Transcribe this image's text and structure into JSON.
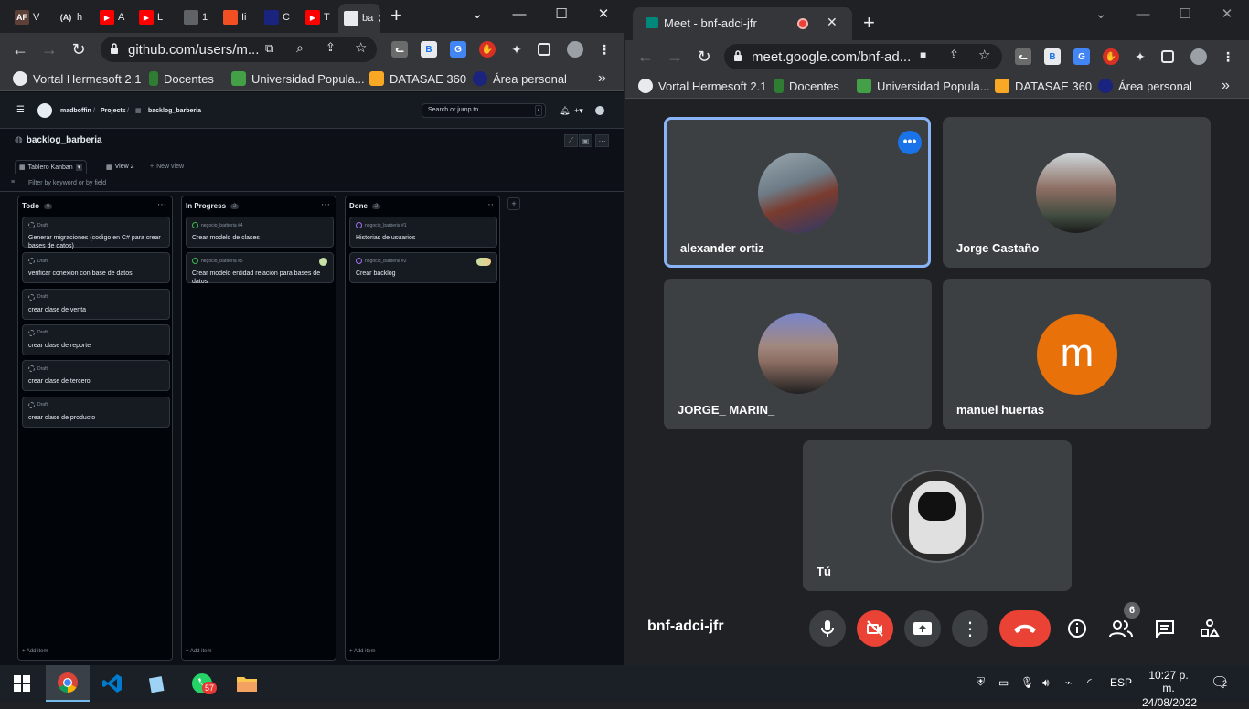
{
  "left_browser": {
    "tabs": [
      {
        "favicon": "AF",
        "label": "V"
      },
      {
        "favicon": "(A)",
        "label": "h"
      },
      {
        "favicon": "youtube",
        "label": "A"
      },
      {
        "favicon": "youtube",
        "label": "L"
      },
      {
        "favicon": "globe",
        "label": "1"
      },
      {
        "favicon": "microsoft",
        "label": "Ii"
      },
      {
        "favicon": "dark",
        "label": "C"
      },
      {
        "favicon": "youtube",
        "label": "T"
      },
      {
        "favicon": "github",
        "label": "ba"
      }
    ],
    "url": "github.com/users/m...",
    "bookmarks": [
      "Vortal Hermesoft 2.1",
      "Docentes",
      "Universidad Popula...",
      "DATASAE 360",
      "Área personal"
    ],
    "more_bookmarks": "»"
  },
  "github": {
    "user": "madboffin",
    "projects": "Projects",
    "project_crumb": "backlog_barberia",
    "search_placeholder": "Search or jump to...",
    "search_key": "/",
    "project_title": "backlog_barberia",
    "views": [
      "Tablero Kanban",
      "View 2",
      "New view"
    ],
    "filter_placeholder": "Filter by keyword or by field",
    "add_item": "Add item",
    "columns": [
      {
        "title": "Todo",
        "count": "6",
        "cards": [
          {
            "meta": "Draft",
            "title": "Generar migraciones (codigo en C# para crear bases de datos)",
            "state": "draft"
          },
          {
            "meta": "Draft",
            "title": "verificar conexion con base de datos",
            "state": "draft"
          },
          {
            "meta": "Draft",
            "title": "crear clase de venta",
            "state": "draft"
          },
          {
            "meta": "Draft",
            "title": "crear clase de reporte",
            "state": "draft"
          },
          {
            "meta": "Draft",
            "title": "crear clase de tercero",
            "state": "draft"
          },
          {
            "meta": "Draft",
            "title": "crear clase de producto",
            "state": "draft"
          }
        ]
      },
      {
        "title": "In Progress",
        "count": "2",
        "cards": [
          {
            "meta": "negocio_barberia #4",
            "title": "Crear modelo de clases",
            "state": "open"
          },
          {
            "meta": "negocio_barberia #5",
            "title": "Crear modelo entidad relacion para bases de datos",
            "state": "open"
          }
        ]
      },
      {
        "title": "Done",
        "count": "2",
        "cards": [
          {
            "meta": "negocio_barberia #1",
            "title": "Historias de usuarios",
            "state": "closed"
          },
          {
            "meta": "negocio_barberia #2",
            "title": "Crear backlog",
            "state": "closed"
          }
        ]
      }
    ]
  },
  "meet_browser": {
    "tab_title": "Meet - bnf-adci-jfr",
    "url": "meet.google.com/bnf-ad...",
    "bookmarks": [
      "Vortal Hermesoft 2.1",
      "Docentes",
      "Universidad Popula...",
      "DATASAE 360",
      "Área personal"
    ],
    "more_bookmarks": "»"
  },
  "meet": {
    "participants": [
      {
        "name": "alexander ortiz",
        "avatar": "photo",
        "active": true
      },
      {
        "name": "Jorge Castaño",
        "avatar": "photo"
      },
      {
        "name": "JORGE_ MARIN_",
        "avatar": "photo"
      },
      {
        "name": "manuel huertas",
        "avatar": "letter",
        "letter": "m"
      },
      {
        "name": "Tú",
        "avatar": "photo"
      }
    ],
    "meeting_code": "bnf-adci-jfr",
    "people_count": "6",
    "colors": {
      "end_call": "#ea4335",
      "accent": "#8ab4f8",
      "tile": "#3c4043",
      "letter_avatar": "#e8710a"
    }
  },
  "taskbar": {
    "whatsapp_badge": "57",
    "language": "ESP",
    "time": "10:27 p. m.",
    "date": "24/08/2022",
    "notifications": "2"
  }
}
